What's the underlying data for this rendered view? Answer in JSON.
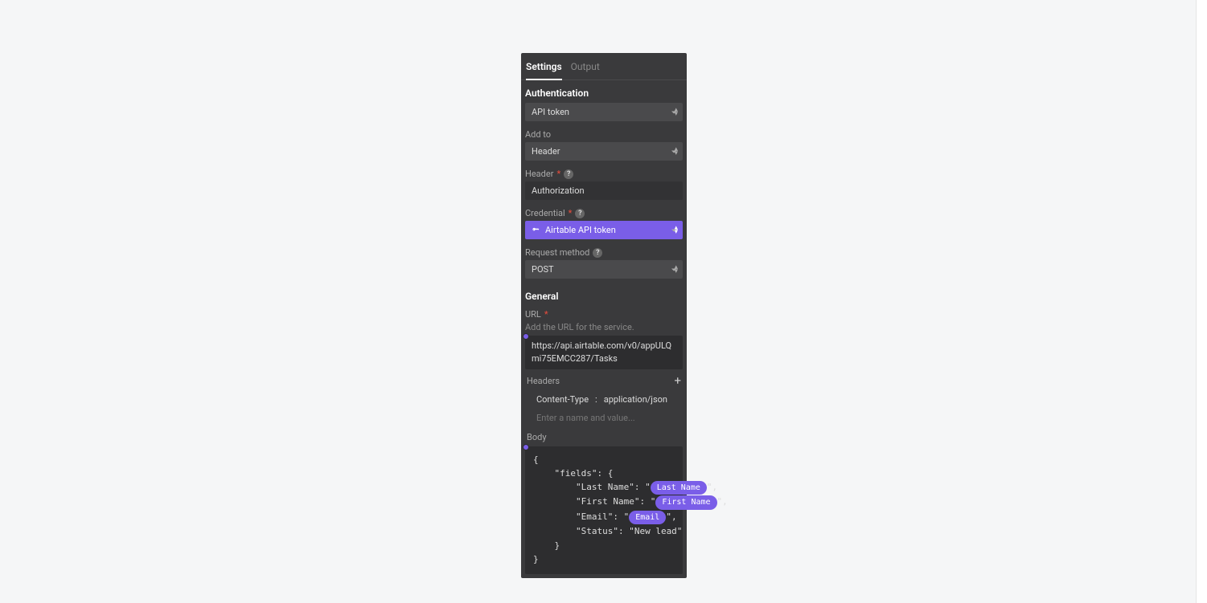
{
  "tabs": {
    "settings": "Settings",
    "output": "Output"
  },
  "auth": {
    "title": "Authentication",
    "type_value": "API token",
    "addto_label": "Add to",
    "addto_value": "Header",
    "header_label": "Header",
    "header_value": "Authorization",
    "credential_label": "Credential",
    "credential_value": "Airtable API token",
    "method_label": "Request method",
    "method_value": "POST"
  },
  "general": {
    "title": "General",
    "url_label": "URL",
    "url_hint": "Add the URL for the service.",
    "url_value": "https://api.airtable.com/v0/appULQmi75EMCC287/Tasks",
    "headers_label": "Headers",
    "header_name": "Content-Type",
    "header_sep": ":",
    "header_val": "application/json",
    "header_placeholder": "Enter a name and value...",
    "body_label": "Body"
  },
  "body": {
    "open": "{",
    "fields": "    \"fields\": {",
    "ln_prefix": "        \"Last Name\": \"",
    "ln_chip": "Last Name",
    "ln_suffix": "\",",
    "fn_prefix": "        \"First Name\": \"",
    "fn_chip": "First Name",
    "fn_suffix": "\",",
    "em_prefix": "        \"Email\": \"",
    "em_chip": "Email",
    "em_suffix": "\",",
    "status": "        \"Status\": \"New lead\"",
    "close_fields": "    }",
    "close": "}"
  }
}
